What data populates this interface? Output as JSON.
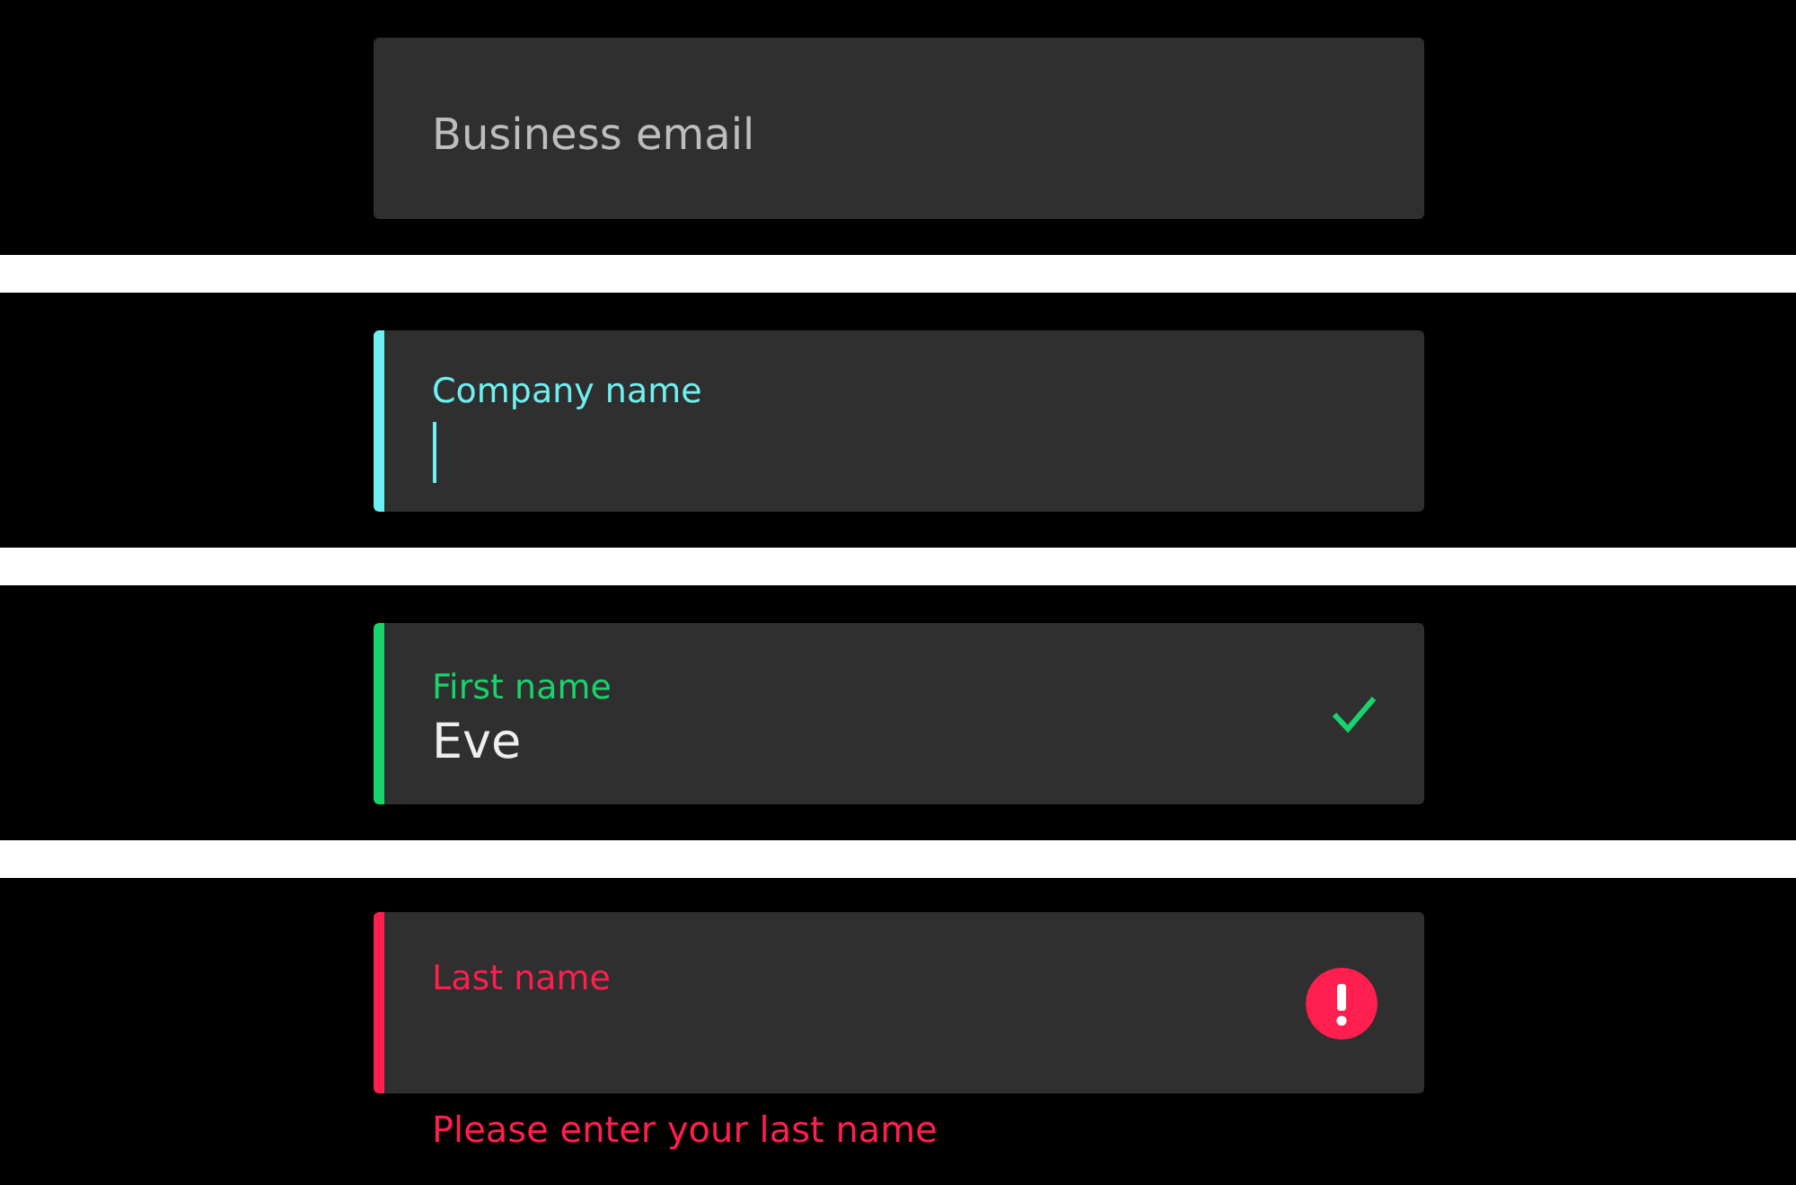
{
  "fields": [
    {
      "label": "Business email",
      "kind": "empty"
    },
    {
      "label": "Company name",
      "kind": "focused"
    },
    {
      "label": "First name",
      "kind": "valid",
      "value": "Eve"
    },
    {
      "label": "Last name",
      "kind": "error",
      "error": "Please enter your last name"
    }
  ]
}
